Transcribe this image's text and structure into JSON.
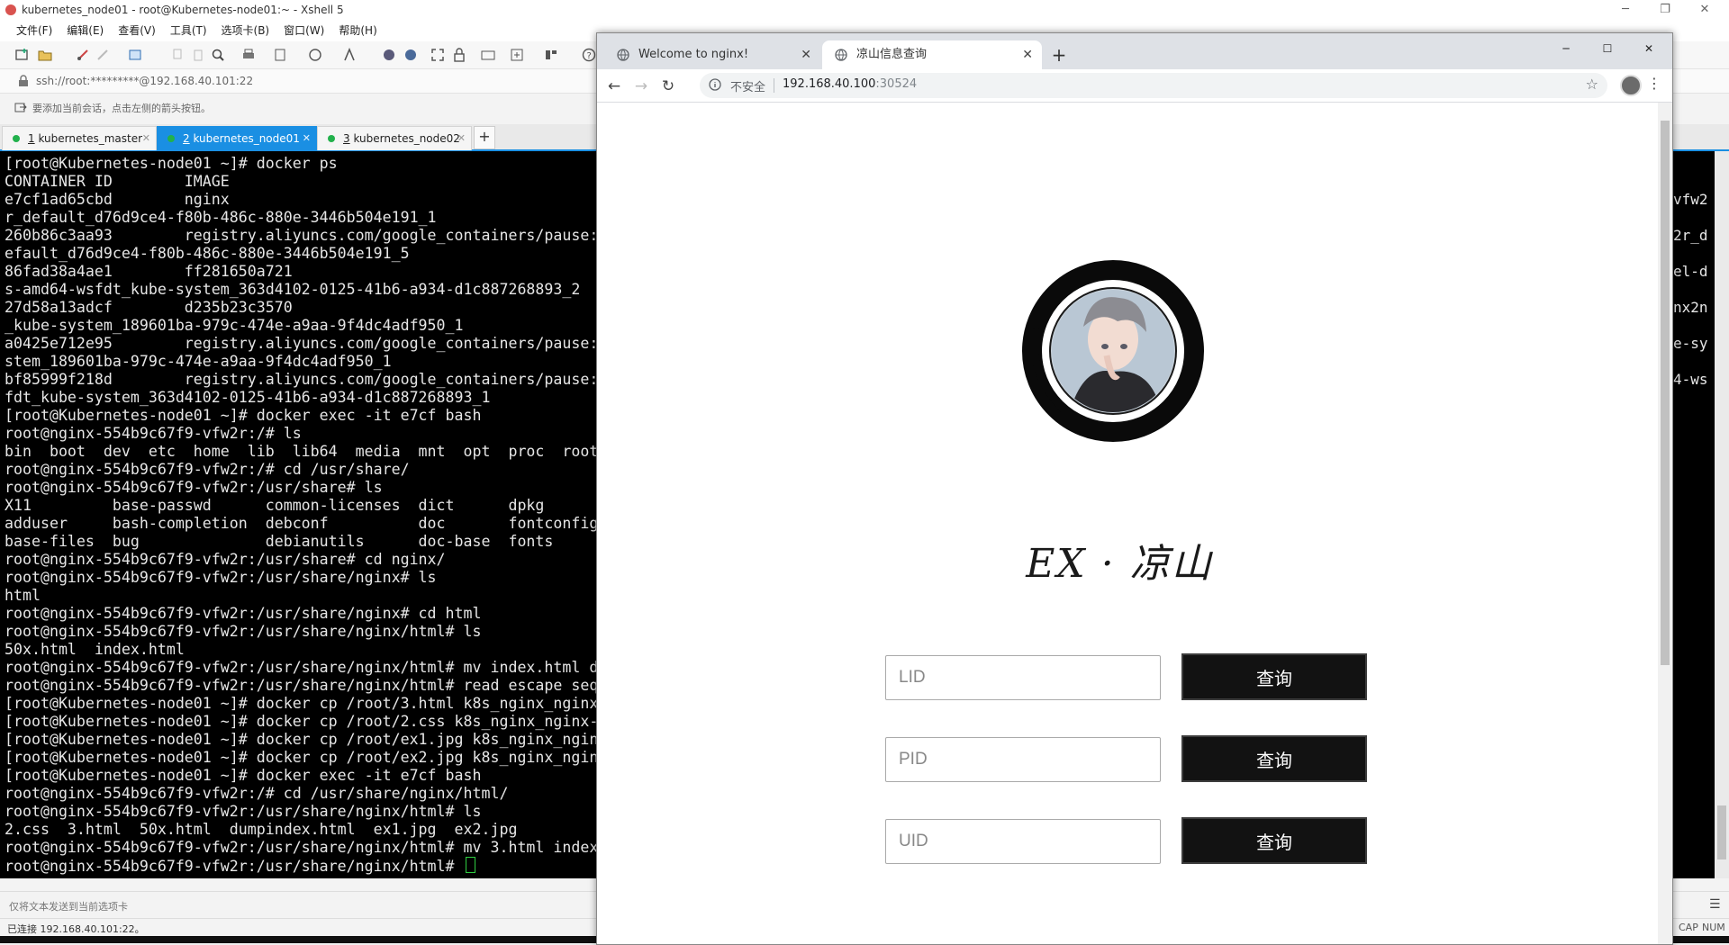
{
  "xshell": {
    "title": "kubernetes_node01 - root@Kubernetes-node01:~ - Xshell 5",
    "menu": [
      "文件(F)",
      "编辑(E)",
      "查看(V)",
      "工具(T)",
      "选项卡(B)",
      "窗口(W)",
      "帮助(H)"
    ],
    "address": "ssh://root:*********@192.168.40.101:22",
    "hint": "要添加当前会话，点击左侧的箭头按钮。",
    "tabs": [
      {
        "num": "1",
        "label": "kubernetes_master"
      },
      {
        "num": "2",
        "label": "kubernetes_node01"
      },
      {
        "num": "3",
        "label": "kubernetes_node02"
      }
    ],
    "add_tab": "+",
    "terminal_lines": [
      "[root@Kubernetes-node01 ~]# docker ps",
      "CONTAINER ID        IMAGE",
      "e7cf1ad65cbd        nginx",
      "r_default_d76d9ce4-f80b-486c-880e-3446b504e191_1",
      "260b86c3aa93        registry.aliyuncs.com/google_containers/pause:",
      "efault_d76d9ce4-f80b-486c-880e-3446b504e191_5",
      "86fad38a4ae1        ff281650a721",
      "s-amd64-wsfdt_kube-system_363d4102-0125-41b6-a934-d1c887268893_2",
      "27d58a13adcf        d235b23c3570",
      "_kube-system_189601ba-979c-474e-a9aa-9f4dc4adf950_1",
      "a0425e712e95        registry.aliyuncs.com/google_containers/pause:",
      "stem_189601ba-979c-474e-a9aa-9f4dc4adf950_1",
      "bf85999f218d        registry.aliyuncs.com/google_containers/pause:",
      "fdt_kube-system_363d4102-0125-41b6-a934-d1c887268893_1",
      "[root@Kubernetes-node01 ~]# docker exec -it e7cf bash",
      "root@nginx-554b9c67f9-vfw2r:/# ls",
      "bin  boot  dev  etc  home  lib  lib64  media  mnt  opt  proc  root",
      "root@nginx-554b9c67f9-vfw2r:/# cd /usr/share/",
      "root@nginx-554b9c67f9-vfw2r:/usr/share# ls",
      "X11         base-passwd      common-licenses  dict      dpkg",
      "adduser     bash-completion  debconf          doc       fontconfig",
      "base-files  bug              debianutils      doc-base  fonts",
      "root@nginx-554b9c67f9-vfw2r:/usr/share# cd nginx/",
      "root@nginx-554b9c67f9-vfw2r:/usr/share/nginx# ls",
      "html",
      "root@nginx-554b9c67f9-vfw2r:/usr/share/nginx# cd html",
      "root@nginx-554b9c67f9-vfw2r:/usr/share/nginx/html# ls",
      "50x.html  index.html",
      "root@nginx-554b9c67f9-vfw2r:/usr/share/nginx/html# mv index.html d",
      "root@nginx-554b9c67f9-vfw2r:/usr/share/nginx/html# read escape seq",
      "[root@Kubernetes-node01 ~]# docker cp /root/3.html k8s_nginx_nginx",
      "[root@Kubernetes-node01 ~]# docker cp /root/2.css k8s_nginx_nginx-",
      "[root@Kubernetes-node01 ~]# docker cp /root/ex1.jpg k8s_nginx_ngin",
      "[root@Kubernetes-node01 ~]# docker cp /root/ex2.jpg k8s_nginx_ngin",
      "[root@Kubernetes-node01 ~]# docker exec -it e7cf bash",
      "root@nginx-554b9c67f9-vfw2r:/# cd /usr/share/nginx/html/",
      "root@nginx-554b9c67f9-vfw2r:/usr/share/nginx/html# ls",
      "2.css  3.html  50x.html  dumpindex.html  ex1.jpg  ex2.jpg",
      "root@nginx-554b9c67f9-vfw2r:/usr/share/nginx/html# mv 3.html index",
      "root@nginx-554b9c67f9-vfw2r:/usr/share/nginx/html# "
    ],
    "terminal_right": [
      "vfw2",
      "2r_d",
      "el-d",
      "nx2n",
      "e-sy",
      "4-ws"
    ],
    "input_placeholder": "仅将文本发送到当前选项卡",
    "status": "已连接 192.168.40.101:22。",
    "status_right": [
      "CAP",
      "NUM"
    ]
  },
  "chrome": {
    "tabs": [
      {
        "title": "Welcome to nginx!"
      },
      {
        "title": "凉山信息查询"
      }
    ],
    "new_tab": "+",
    "url_warning": "不安全",
    "url_host": "192.168.40.100",
    "url_port": ":30524",
    "page": {
      "brand": "EX · 凉山",
      "queries": [
        {
          "placeholder": "LID",
          "button": "查询"
        },
        {
          "placeholder": "PID",
          "button": "查询"
        },
        {
          "placeholder": "UID",
          "button": "查询"
        }
      ]
    }
  }
}
